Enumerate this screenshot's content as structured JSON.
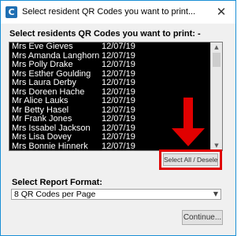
{
  "window": {
    "title": "Select resident QR Codes you want to print...",
    "app_icon_letter": "C",
    "close_glyph": "✕"
  },
  "prompt": "Select residents QR Codes you want to print: -",
  "residents": [
    {
      "name": "Mrs Eve Gieves",
      "date": "12/07/19"
    },
    {
      "name": "Mrs Amanda Langhorn",
      "date": "12/07/19"
    },
    {
      "name": "Mrs Polly Drake",
      "date": "12/07/19"
    },
    {
      "name": "Mrs Esther Goulding",
      "date": "12/07/19"
    },
    {
      "name": "Mrs Laura Derby",
      "date": "12/07/19"
    },
    {
      "name": "Mrs Doreen Hache",
      "date": "12/07/19"
    },
    {
      "name": "Mr Alice Lauks",
      "date": "12/07/19"
    },
    {
      "name": "Mr Betty Hasel",
      "date": "12/07/19"
    },
    {
      "name": "Mr Frank Jones",
      "date": "12/07/19"
    },
    {
      "name": "Mrs Issabel Jackson",
      "date": "12/07/19"
    },
    {
      "name": "Mrs Lisa Dovey",
      "date": "12/07/19"
    },
    {
      "name": "Mrs Bonnie Hinnerk",
      "date": "12/07/19"
    }
  ],
  "select_all_label": "Select All / Deselect All",
  "report_format": {
    "label": "Select Report Format:",
    "value": "8 QR Codes per Page"
  },
  "continue_label": "Continue...",
  "colors": {
    "annotation_red": "#e00000",
    "list_background": "#000000",
    "window_border": "#1a8fd6"
  },
  "icons": {
    "app": "app-logo-icon",
    "close": "close-icon",
    "scroll_up": "scroll-up-icon",
    "scroll_down": "scroll-down-icon",
    "dropdown": "chevron-down-icon"
  }
}
